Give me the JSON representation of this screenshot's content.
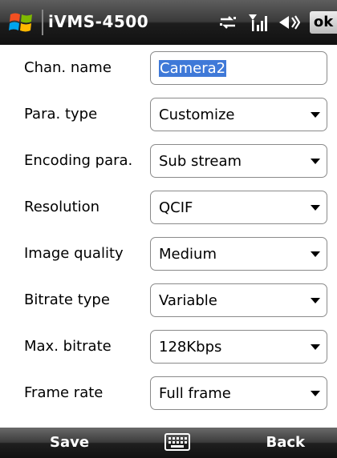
{
  "titlebar": {
    "app_title": "iVMS-4500",
    "ok_label": "ok",
    "icons": [
      "windows-logo-icon",
      "connectivity-icon",
      "signal-icon",
      "volume-icon"
    ]
  },
  "form": {
    "rows": [
      {
        "label": "Chan. name",
        "value": "Camera2",
        "type": "text"
      },
      {
        "label": "Para. type",
        "value": "Customize",
        "type": "select"
      },
      {
        "label": "Encoding para.",
        "value": "Sub stream",
        "type": "select"
      },
      {
        "label": "Resolution",
        "value": "QCIF",
        "type": "select"
      },
      {
        "label": "Image quality",
        "value": "Medium",
        "type": "select"
      },
      {
        "label": "Bitrate type",
        "value": "Variable",
        "type": "select"
      },
      {
        "label": "Max. bitrate",
        "value": "128Kbps",
        "type": "select"
      },
      {
        "label": "Frame rate",
        "value": "Full frame",
        "type": "select"
      }
    ]
  },
  "softbar": {
    "left_label": "Save",
    "right_label": "Back",
    "center_icon": "keyboard-icon"
  },
  "colors": {
    "selection": "#3f79d8",
    "bar_dark": "#121212"
  }
}
